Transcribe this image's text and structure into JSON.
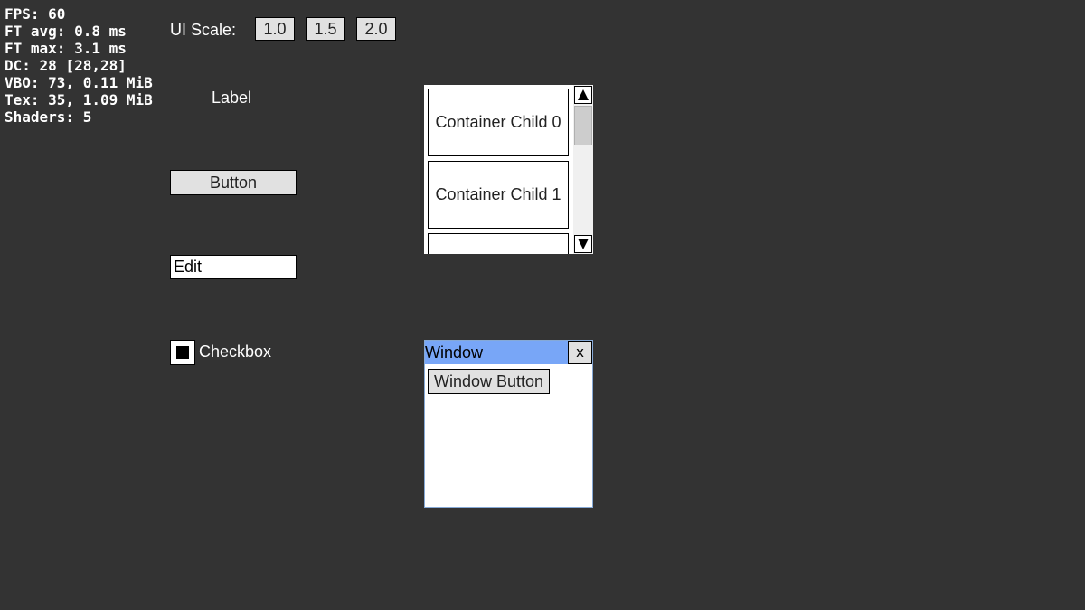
{
  "stats": {
    "lines": [
      "FPS: 60",
      "FT avg: 0.8 ms",
      "FT max: 3.1 ms",
      "DC: 28 [28,28]",
      "VBO: 73, 0.11 MiB",
      "Tex: 35, 1.09 MiB",
      "Shaders: 5"
    ]
  },
  "ui_scale": {
    "label": "UI Scale:",
    "options": [
      "1.0",
      "1.5",
      "2.0"
    ]
  },
  "label": {
    "text": "Label"
  },
  "button": {
    "label": "Button"
  },
  "edit": {
    "value": "Edit"
  },
  "checkbox": {
    "label": "Checkbox",
    "checked": true
  },
  "container": {
    "children": [
      "Container Child 0",
      "Container Child 1",
      ""
    ],
    "scroll_up_icon": "triangle-up",
    "scroll_down_icon": "triangle-down"
  },
  "window": {
    "title": "Window",
    "close_label": "x",
    "button_label": "Window Button",
    "titlebar_color": "#78a6f7"
  }
}
